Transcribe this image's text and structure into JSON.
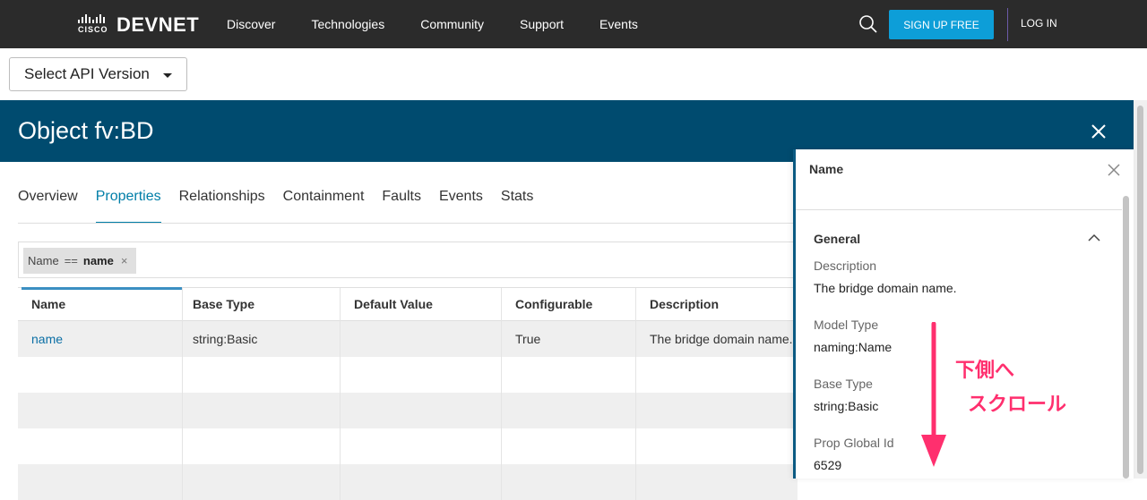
{
  "nav": {
    "brand_small": "CISCO",
    "brand": "DEVNET",
    "links": [
      "Discover",
      "Technologies",
      "Community",
      "Support",
      "Events"
    ],
    "signup": "SIGN UP FREE",
    "login": "LOG IN"
  },
  "api_version": {
    "label": "Select API Version"
  },
  "object": {
    "title": "Object fv:BD"
  },
  "tabs": [
    "Overview",
    "Properties",
    "Relationships",
    "Containment",
    "Faults",
    "Events",
    "Stats"
  ],
  "active_tab": "Properties",
  "filter": {
    "field": "Name",
    "op": "==",
    "value": "name",
    "remove": "×"
  },
  "table": {
    "headers": [
      "Name",
      "Base Type",
      "Default Value",
      "Configurable",
      "Description"
    ],
    "rows": [
      [
        "name",
        "string:Basic",
        "",
        "True",
        "The bridge domain name."
      ]
    ]
  },
  "panel": {
    "title": "Name",
    "section": "General",
    "fields": [
      {
        "label": "Description",
        "value": "The bridge domain name."
      },
      {
        "label": "Model Type",
        "value": "naming:Name"
      },
      {
        "label": "Base Type",
        "value": "string:Basic"
      },
      {
        "label": "Prop Global Id",
        "value": "6529"
      }
    ]
  },
  "annotation": {
    "line1": "下側へ",
    "line2": "スクロール",
    "color": "#ff2f6e"
  }
}
